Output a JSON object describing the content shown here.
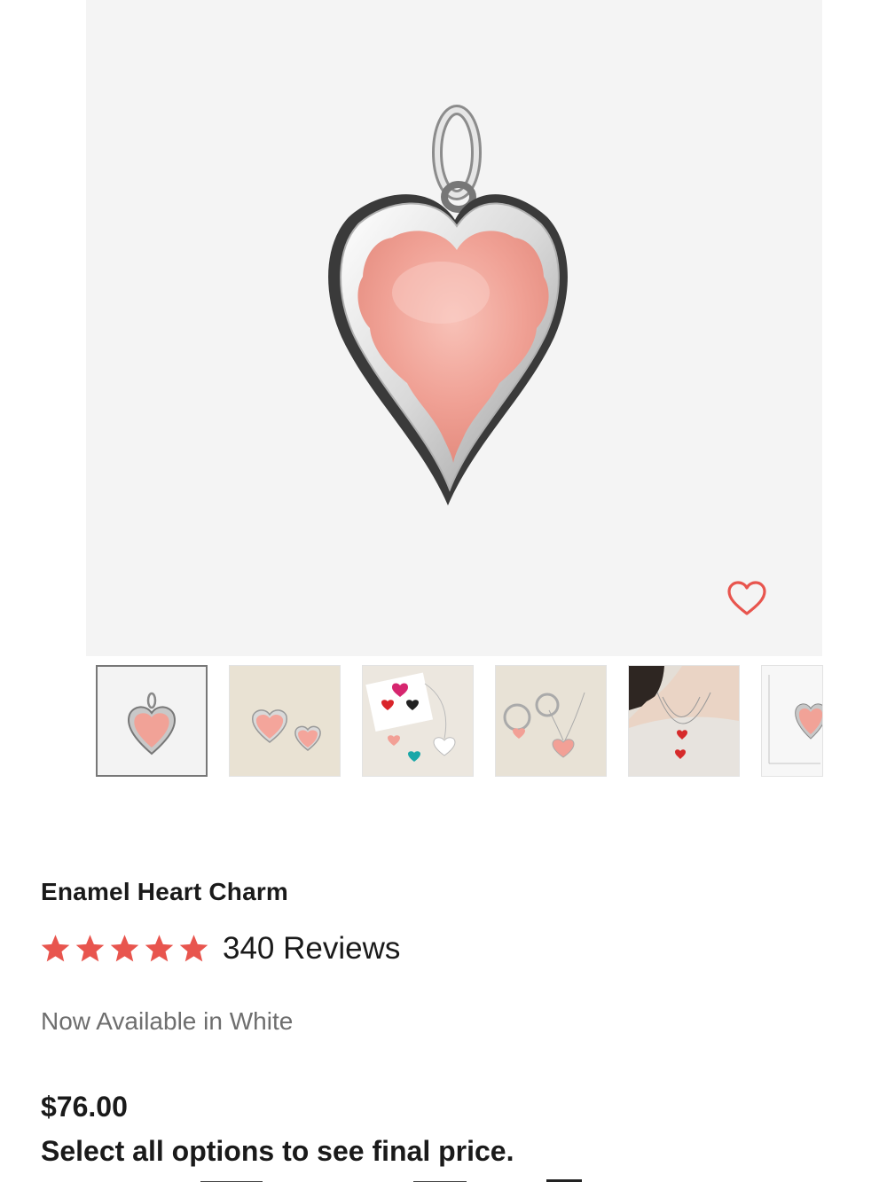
{
  "product": {
    "image_icon": "enamel-heart-charm-image",
    "wishlist_icon": "heart-outline-icon",
    "title": "Enamel Heart Charm",
    "rating": 5,
    "rating_max": 5,
    "reviews_label": "340 Reviews",
    "availability_note": "Now Available in White",
    "price": "$76.00",
    "price_note": "Select all options to see final price."
  },
  "thumbnails": [
    {
      "icon": "pink-heart-charm-thumb",
      "active": true
    },
    {
      "icon": "two-pink-hearts-thumb",
      "active": false
    },
    {
      "icon": "colorful-hearts-flatlay-thumb",
      "active": false
    },
    {
      "icon": "chain-and-charm-thumb",
      "active": false
    },
    {
      "icon": "model-wearing-necklace-thumb",
      "active": false
    },
    {
      "icon": "size-chart-thumb",
      "active": false
    }
  ],
  "colors": {
    "accent": "#e8554e",
    "enamel_pink": "#f0a096",
    "hero_bg": "#f4f4f4"
  }
}
